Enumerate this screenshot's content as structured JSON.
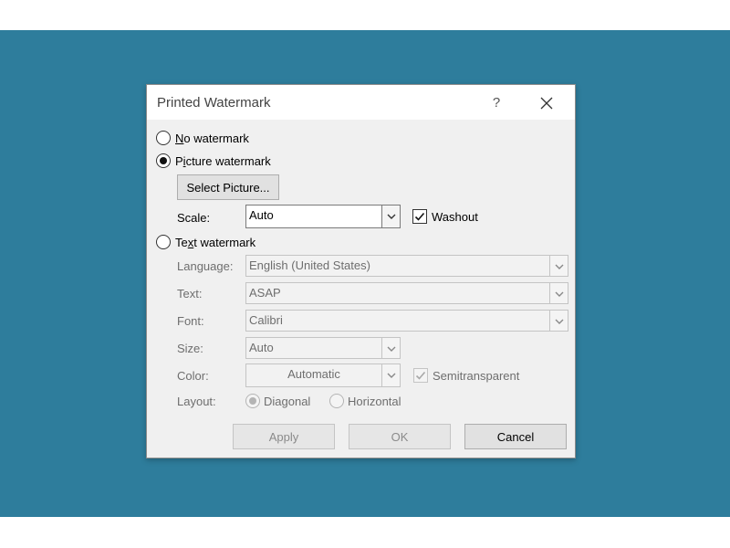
{
  "dialog": {
    "title": "Printed Watermark",
    "help_glyph": "?"
  },
  "options": {
    "no_watermark": "No watermark",
    "picture_watermark": "Picture watermark",
    "text_watermark": "Text watermark"
  },
  "picture": {
    "select_button": "Select Picture...",
    "scale_label": "Scale:",
    "scale_value": "Auto",
    "washout_label": "Washout",
    "washout_checked": true
  },
  "text": {
    "language_label": "Language:",
    "language_value": "English (United States)",
    "text_label": "Text:",
    "text_value": "ASAP",
    "font_label": "Font:",
    "font_value": "Calibri",
    "size_label": "Size:",
    "size_value": "Auto",
    "color_label": "Color:",
    "color_value": "Automatic",
    "semitransparent_label": "Semitransparent",
    "layout_label": "Layout:",
    "diagonal_label": "Diagonal",
    "horizontal_label": "Horizontal"
  },
  "buttons": {
    "apply": "Apply",
    "ok": "OK",
    "cancel": "Cancel"
  },
  "colors": {
    "backdrop": "#2e7d9c",
    "dialog": "#f0f0f0",
    "disabled_text": "#6e6e6e"
  },
  "icons": {
    "close": "close-icon",
    "dropdown": "chevron-down-icon",
    "check": "checkmark-icon"
  }
}
